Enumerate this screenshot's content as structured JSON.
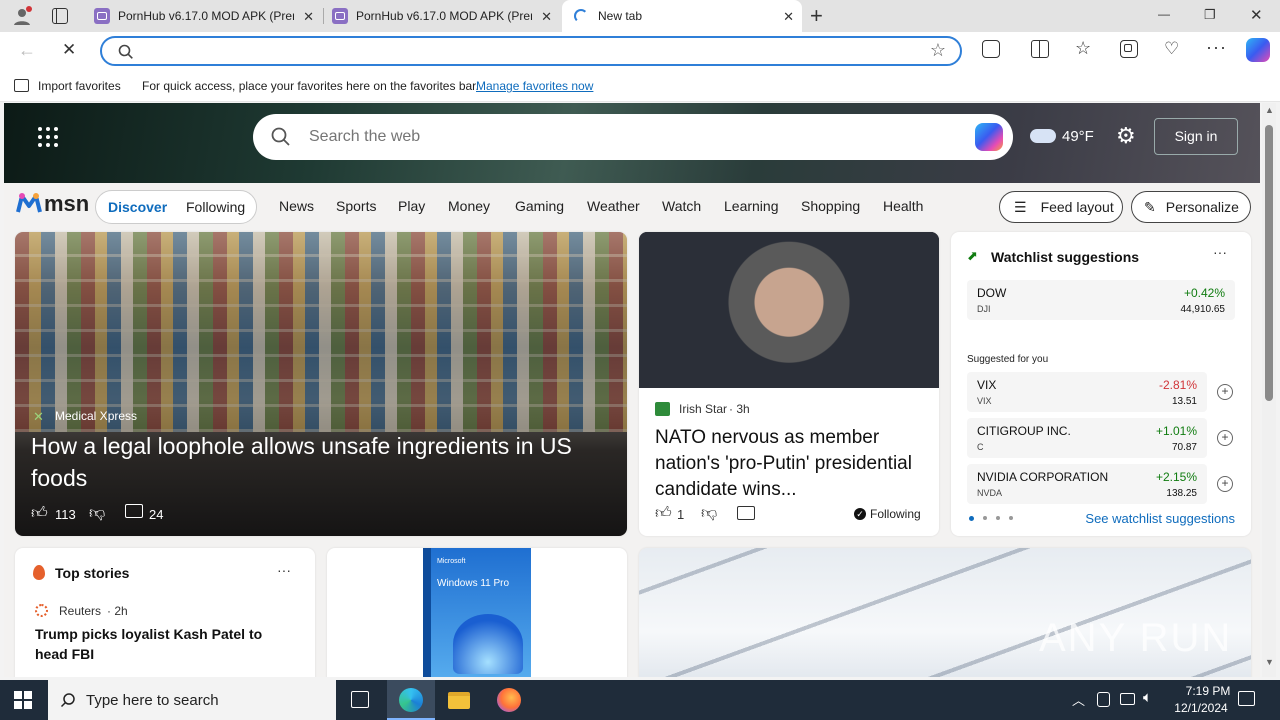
{
  "browser": {
    "tabs": [
      {
        "title": "PornHub v6.17.0 MOD APK (Prem"
      },
      {
        "title": "PornHub v6.17.0 MOD APK (Prem"
      },
      {
        "title": "New tab"
      }
    ],
    "new_tab_symbol": "+",
    "window_controls": {
      "minimize": "—",
      "restore": "❐",
      "close": "✕"
    },
    "address_value": "",
    "favorites_bar": {
      "import": "Import favorites",
      "hint": "For quick access, place your favorites here on the favorites bar.",
      "manage_link": "Manage favorites now"
    }
  },
  "msn": {
    "search_placeholder": "Search the web",
    "weather": {
      "temp": "49°F"
    },
    "sign_in": "Sign in",
    "logo": "msn",
    "tabs": [
      "Discover",
      "Following"
    ],
    "nav": [
      "News",
      "Sports",
      "Play",
      "Money",
      "Gaming",
      "Weather",
      "Watch",
      "Learning",
      "Shopping",
      "Health"
    ],
    "feed_layout": "Feed layout",
    "personalize": "Personalize",
    "hero_story": {
      "source": "Medical Xpress",
      "headline": "How a legal loophole allows unsafe ingredients in US foods",
      "likes": "113",
      "comments": "24"
    },
    "story2": {
      "source": "Irish Star",
      "time": "· 3h",
      "headline": "NATO nervous as member nation's 'pro-Putin' presidential candidate wins...",
      "likes": "1",
      "following": "Following"
    },
    "watchlist": {
      "title": "Watchlist suggestions",
      "suggested_label": "Suggested for you",
      "see_more": "See watchlist suggestions",
      "top": {
        "name": "DOW",
        "ticker": "DJI",
        "change": "+0.42%",
        "price": "44,910.65"
      },
      "suggested": [
        {
          "name": "VIX",
          "ticker": "VIX",
          "change": "-2.81%",
          "price": "13.51"
        },
        {
          "name": "CITIGROUP INC.",
          "ticker": "C",
          "change": "+1.01%",
          "price": "70.87"
        },
        {
          "name": "NVIDIA CORPORATION",
          "ticker": "NVDA",
          "change": "+2.15%",
          "price": "138.25"
        }
      ]
    },
    "top_stories": {
      "title": "Top stories",
      "source": "Reuters",
      "time": "· 2h",
      "headline": "Trump picks loyalist Kash Patel to head FBI"
    },
    "ad": {
      "box_brand": "Microsoft",
      "box_title": "Windows 11 Pro"
    },
    "watermark": "ANY RUN"
  },
  "taskbar": {
    "search_placeholder": "Type here to search",
    "time": "7:19 PM",
    "date": "12/1/2024"
  },
  "colors": {
    "accent": "#0f6cbd",
    "positive": "#107c10",
    "negative": "#d13438",
    "taskbar": "#1f2c3a"
  }
}
